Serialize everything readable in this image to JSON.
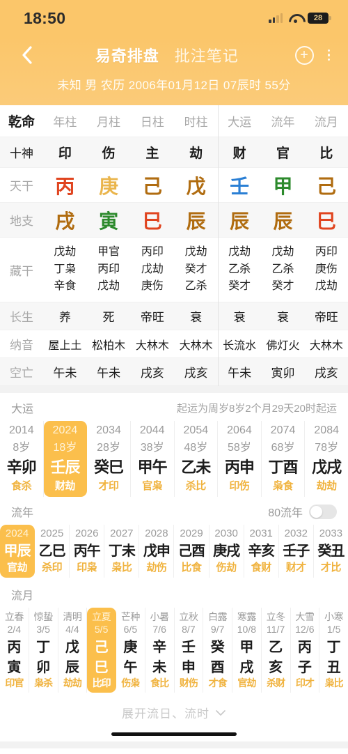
{
  "status_bar": {
    "time": "18:50",
    "battery": "28",
    "wifi_icon": "wifi-icon",
    "signal_icon": "signal-bars-icon"
  },
  "header": {
    "back_icon": "chevron-left-icon",
    "tab_active": "易奇排盘",
    "tab_inactive": "批注笔记",
    "add_icon": "plus-circle-icon",
    "more_icon": "more-vertical-icon",
    "birth_info": "未知 男 农历 2006年01月12日 07辰时 55分"
  },
  "chart_table": {
    "row_labels": {
      "title": "乾命",
      "shishen": "十神",
      "tiangan": "天干",
      "dizhi": "地支",
      "canggan": "藏干",
      "changsheng": "长生",
      "nayin": "纳音",
      "kongwang": "空亡"
    },
    "pillar_headers": [
      "年柱",
      "月柱",
      "日柱",
      "时柱"
    ],
    "luck_headers": [
      "大运",
      "流年",
      "流月"
    ],
    "shishen": [
      "印",
      "伤",
      "主",
      "劫"
    ],
    "shishen_luck": [
      "财",
      "官",
      "比"
    ],
    "tiangan": [
      {
        "char": "丙",
        "element": "fire"
      },
      {
        "char": "庚",
        "element": "metal"
      },
      {
        "char": "己",
        "element": "earth"
      },
      {
        "char": "戊",
        "element": "earth"
      }
    ],
    "tiangan_luck": [
      {
        "char": "壬",
        "element": "water"
      },
      {
        "char": "甲",
        "element": "wood"
      },
      {
        "char": "己",
        "element": "earth"
      }
    ],
    "dizhi": [
      {
        "char": "戌",
        "element": "earth"
      },
      {
        "char": "寅",
        "element": "wood"
      },
      {
        "char": "巳",
        "element": "fire"
      },
      {
        "char": "辰",
        "element": "earth"
      }
    ],
    "dizhi_luck": [
      {
        "char": "辰",
        "element": "earth"
      },
      {
        "char": "辰",
        "element": "earth"
      },
      {
        "char": "巳",
        "element": "fire"
      }
    ],
    "canggan": [
      [
        "戊劫",
        "丁枭",
        "辛食"
      ],
      [
        "甲官",
        "丙印",
        "戊劫"
      ],
      [
        "丙印",
        "戊劫",
        "庚伤"
      ],
      [
        "戊劫",
        "癸才",
        "乙杀"
      ]
    ],
    "canggan_luck": [
      [
        "戊劫",
        "乙杀",
        "癸才"
      ],
      [
        "戊劫",
        "乙杀",
        "癸才"
      ],
      [
        "丙印",
        "庚伤",
        "戊劫"
      ]
    ],
    "changsheng": [
      "养",
      "死",
      "帝旺",
      "衰"
    ],
    "changsheng_luck": [
      "衰",
      "衰",
      "帝旺"
    ],
    "nayin": [
      "屋上土",
      "松柏木",
      "大林木",
      "大林木"
    ],
    "nayin_luck": [
      "长流水",
      "佛灯火",
      "大林木"
    ],
    "kongwang": [
      "午未",
      "午未",
      "戌亥",
      "戌亥"
    ],
    "kongwang_luck": [
      "午未",
      "寅卯",
      "戌亥"
    ]
  },
  "dayun": {
    "title": "大运",
    "note": "起运为周岁8岁2个月29天20时起运",
    "items": [
      {
        "year": "2014",
        "age": "8岁",
        "ganzhi": "辛卯",
        "shishen": "食杀",
        "selected": false
      },
      {
        "year": "2024",
        "age": "18岁",
        "ganzhi": "壬辰",
        "shishen": "财劫",
        "selected": true
      },
      {
        "year": "2034",
        "age": "28岁",
        "ganzhi": "癸巳",
        "shishen": "才印",
        "selected": false
      },
      {
        "year": "2044",
        "age": "38岁",
        "ganzhi": "甲午",
        "shishen": "官枭",
        "selected": false
      },
      {
        "year": "2054",
        "age": "48岁",
        "ganzhi": "乙未",
        "shishen": "杀比",
        "selected": false
      },
      {
        "year": "2064",
        "age": "58岁",
        "ganzhi": "丙申",
        "shishen": "印伤",
        "selected": false
      },
      {
        "year": "2074",
        "age": "68岁",
        "ganzhi": "丁酉",
        "shishen": "枭食",
        "selected": false
      },
      {
        "year": "2084",
        "age": "78岁",
        "ganzhi": "戊戌",
        "shishen": "劫劫",
        "selected": false
      }
    ]
  },
  "liunian": {
    "title": "流年",
    "toggle_label": "80流年",
    "toggle_on": false,
    "items": [
      {
        "year": "2024",
        "ganzhi": "甲辰",
        "shishen": "官劫",
        "selected": true
      },
      {
        "year": "2025",
        "ganzhi": "乙巳",
        "shishen": "杀印",
        "selected": false
      },
      {
        "year": "2026",
        "ganzhi": "丙午",
        "shishen": "印枭",
        "selected": false
      },
      {
        "year": "2027",
        "ganzhi": "丁未",
        "shishen": "枭比",
        "selected": false
      },
      {
        "year": "2028",
        "ganzhi": "戊申",
        "shishen": "劫伤",
        "selected": false
      },
      {
        "year": "2029",
        "ganzhi": "己酉",
        "shishen": "比食",
        "selected": false
      },
      {
        "year": "2030",
        "ganzhi": "庚戌",
        "shishen": "伤劫",
        "selected": false
      },
      {
        "year": "2031",
        "ganzhi": "辛亥",
        "shishen": "食财",
        "selected": false
      },
      {
        "year": "2032",
        "ganzhi": "壬子",
        "shishen": "财才",
        "selected": false
      },
      {
        "year": "2033",
        "ganzhi": "癸丑",
        "shishen": "才比",
        "selected": false
      }
    ]
  },
  "liuyue": {
    "title": "流月",
    "items": [
      {
        "jieqi": "立春",
        "date": "2/4",
        "gan": "丙",
        "zhi": "寅",
        "shishen": "印官",
        "selected": false
      },
      {
        "jieqi": "惊蛰",
        "date": "3/5",
        "gan": "丁",
        "zhi": "卯",
        "shishen": "枭杀",
        "selected": false
      },
      {
        "jieqi": "清明",
        "date": "4/4",
        "gan": "戊",
        "zhi": "辰",
        "shishen": "劫劫",
        "selected": false
      },
      {
        "jieqi": "立夏",
        "date": "5/5",
        "gan": "己",
        "zhi": "巳",
        "shishen": "比印",
        "selected": true
      },
      {
        "jieqi": "芒种",
        "date": "6/5",
        "gan": "庚",
        "zhi": "午",
        "shishen": "伤枭",
        "selected": false
      },
      {
        "jieqi": "小暑",
        "date": "7/6",
        "gan": "辛",
        "zhi": "未",
        "shishen": "食比",
        "selected": false
      },
      {
        "jieqi": "立秋",
        "date": "8/7",
        "gan": "壬",
        "zhi": "申",
        "shishen": "财伤",
        "selected": false
      },
      {
        "jieqi": "白露",
        "date": "9/7",
        "gan": "癸",
        "zhi": "酉",
        "shishen": "才食",
        "selected": false
      },
      {
        "jieqi": "寒露",
        "date": "10/8",
        "gan": "甲",
        "zhi": "戌",
        "shishen": "官劫",
        "selected": false
      },
      {
        "jieqi": "立冬",
        "date": "11/7",
        "gan": "乙",
        "zhi": "亥",
        "shishen": "杀财",
        "selected": false
      },
      {
        "jieqi": "大雪",
        "date": "12/6",
        "gan": "丙",
        "zhi": "子",
        "shishen": "印才",
        "selected": false
      },
      {
        "jieqi": "小寒",
        "date": "1/5",
        "gan": "丁",
        "zhi": "丑",
        "shishen": "枭比",
        "selected": false
      }
    ]
  },
  "footer": {
    "expand_label": "展开流日、流时",
    "expand_icon": "chevron-down-icon"
  },
  "colors": {
    "accent": "#fbbf4c",
    "header_bg": "#fbc66a",
    "fire": "#e0441f",
    "metal": "#eab54c",
    "earth": "#b06c10",
    "wood": "#2c8a2c",
    "water": "#2a7fd4",
    "shishen_gold": "#f0b33f"
  }
}
